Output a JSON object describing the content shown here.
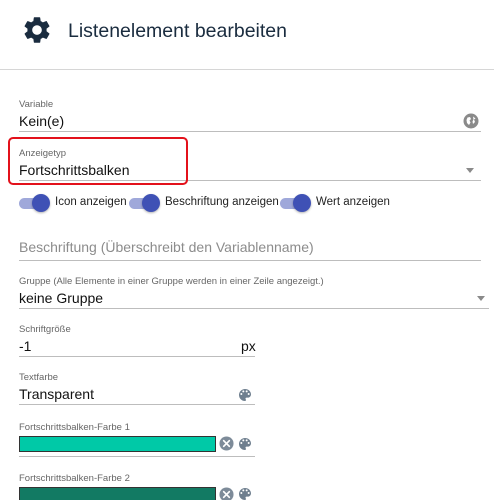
{
  "header": {
    "title": "Listenelement bearbeiten",
    "icon": "gear-icon"
  },
  "variable": {
    "label": "Variable",
    "value": "Kein(e)",
    "icon": "globe-icon"
  },
  "anzeigetyp": {
    "label": "Anzeigetyp",
    "value": "Fortschrittsbalken"
  },
  "toggles": [
    {
      "label": "Icon anzeigen",
      "on": true
    },
    {
      "label": "Beschriftung anzeigen",
      "on": true
    },
    {
      "label": "Wert anzeigen",
      "on": true
    }
  ],
  "beschriftung": {
    "placeholder": "Beschriftung (Überschreibt den Variablenname)"
  },
  "gruppe": {
    "label": "Gruppe (Alle Elemente in einer Gruppe werden in einer Zeile angezeigt.)",
    "value": "keine Gruppe"
  },
  "schriftgroesse": {
    "label": "Schriftgröße",
    "value": "-1",
    "unit": "px"
  },
  "textfarbe": {
    "label": "Textfarbe",
    "value": "Transparent",
    "icon": "palette-icon"
  },
  "farbe1": {
    "label": "Fortschrittsbalken-Farbe 1",
    "color": "#00c9a7"
  },
  "farbe2": {
    "label": "Fortschrittsbalken-Farbe 2",
    "color": "#127a63"
  },
  "colors": {
    "accent": "#3f51b5",
    "highlight": "#e3111b"
  }
}
